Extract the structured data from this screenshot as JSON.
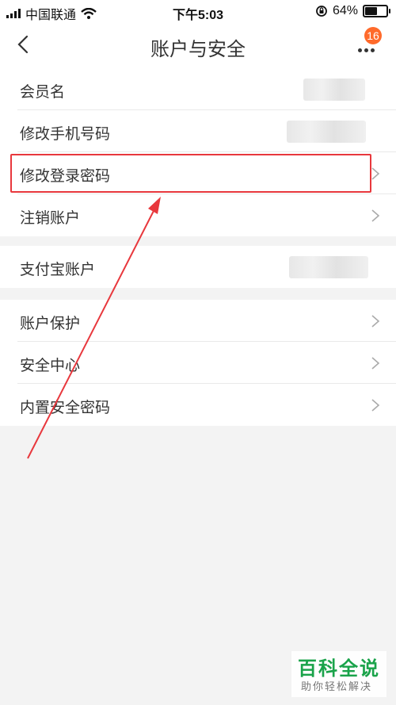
{
  "status_bar": {
    "carrier": "中国联通",
    "time": "下午5:03",
    "battery_percent": "64%",
    "battery_level": 0.64
  },
  "nav": {
    "title": "账户与安全",
    "badge_count": "16",
    "icons": {
      "back": "chevron-left-icon",
      "more": "more-dots-icon"
    }
  },
  "groups": [
    {
      "items": [
        {
          "label": "会员名",
          "value_blurred": true
        },
        {
          "label": "修改手机号码",
          "value_blurred": true
        },
        {
          "label": "修改登录密码",
          "chevron": true,
          "highlighted": true
        },
        {
          "label": "注销账户",
          "chevron": true
        }
      ]
    },
    {
      "items": [
        {
          "label": "支付宝账户",
          "value_blurred": true
        }
      ]
    },
    {
      "items": [
        {
          "label": "账户保护",
          "chevron": true
        },
        {
          "label": "安全中心",
          "chevron": true
        },
        {
          "label": "内置安全密码",
          "chevron": true
        }
      ]
    }
  ],
  "annotation": {
    "box_color": "#e8383d",
    "arrow_color": "#e8383d"
  },
  "watermark": {
    "title": "百科全说",
    "subtitle": "助你轻松解决"
  },
  "colors": {
    "accent_badge": "#ff6a2b",
    "watermark_green": "#1aa34a"
  }
}
